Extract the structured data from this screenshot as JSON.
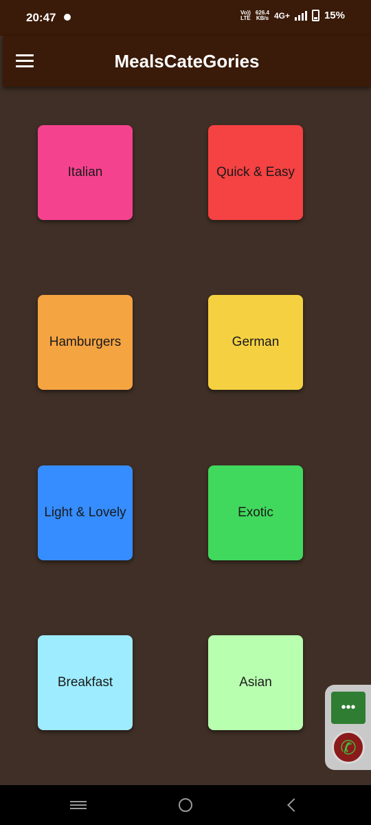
{
  "status_bar": {
    "time": "20:47",
    "volte_top": "Vo))",
    "volte_bottom": "LTE",
    "speed_value": "626.4",
    "speed_unit": "KB/s",
    "network": "4G+",
    "battery": "15%"
  },
  "app_bar": {
    "title": "MealsCateGories",
    "menu_icon": "hamburger-menu-icon"
  },
  "categories": [
    {
      "label": "Italian",
      "color": "#f5428f"
    },
    {
      "label": "Quick & Easy",
      "color": "#f54242"
    },
    {
      "label": "Hamburgers",
      "color": "#f5a442"
    },
    {
      "label": "German",
      "color": "#f5d142"
    },
    {
      "label": "Light & Lovely",
      "color": "#368dff"
    },
    {
      "label": "Exotic",
      "color": "#41d95d"
    },
    {
      "label": "Breakfast",
      "color": "#9eecff"
    },
    {
      "label": "Asian",
      "color": "#b9ffb0"
    }
  ],
  "floating_widget": {
    "message_icon": "ellipsis-icon",
    "message_glyph": "•••",
    "call_icon": "phone-icon",
    "call_glyph": "✆"
  },
  "nav_bar": {
    "recents_icon": "recents-icon",
    "home_icon": "home-icon",
    "back_icon": "back-icon"
  }
}
